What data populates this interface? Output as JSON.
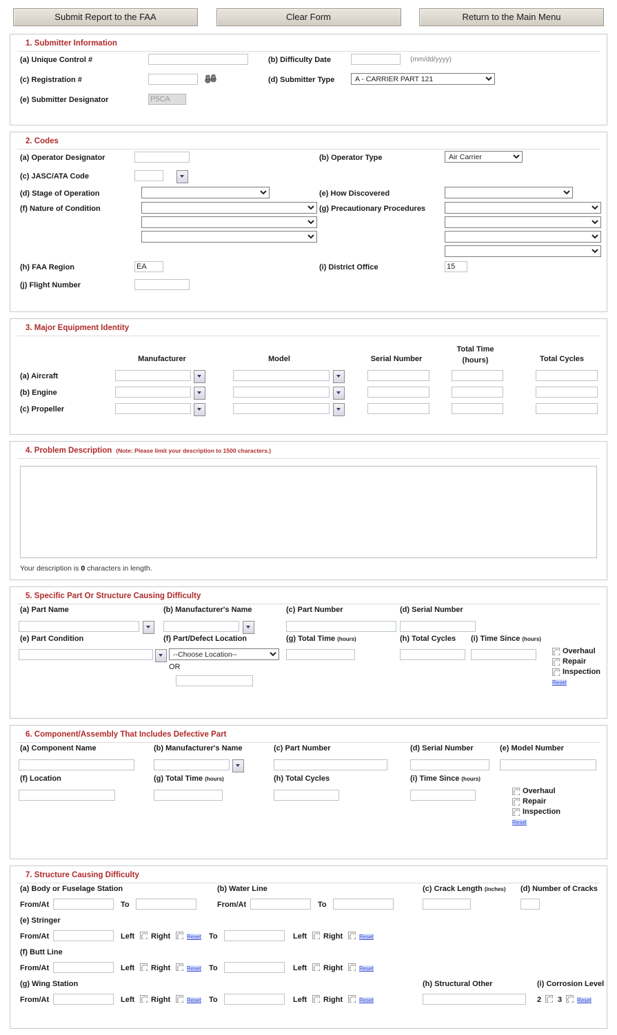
{
  "toolbar": {
    "submit_label": "Submit Report to the FAA",
    "clear_label": "Clear Form",
    "return_label": "Return to the Main Menu"
  },
  "section1": {
    "title": "1. Submitter Information",
    "unique_control_label": "(a) Unique Control #",
    "unique_control_value": "",
    "difficulty_date_label": "(b) Difficulty Date",
    "difficulty_date_value": "",
    "difficulty_date_format": "(mm/dd/yyyy)",
    "registration_label": "(c) Registration #",
    "registration_value": "",
    "submitter_type_label": "(d) Submitter Type",
    "submitter_type_value": "A - CARRIER PART 121",
    "submitter_designator_label": "(e) Submitter Designator",
    "submitter_designator_value": "P5CA"
  },
  "section2": {
    "title": "2. Codes",
    "operator_designator_label": "(a) Operator Designator",
    "operator_designator_value": "",
    "operator_type_label": "(b) Operator Type",
    "operator_type_value": "Air Carrier",
    "jasc_label": "(c) JASC/ATA Code",
    "jasc_value": "",
    "stage_label": "(d) Stage of Operation",
    "stage_value": "",
    "how_discovered_label": "(e) How Discovered",
    "how_discovered_value": "",
    "nature_label": "(f) Nature of Condition",
    "nature_values": [
      "",
      "",
      ""
    ],
    "precautionary_label": "(g) Precautionary Procedures",
    "precautionary_values": [
      "",
      "",
      "",
      ""
    ],
    "faa_region_label": "(h) FAA Region",
    "faa_region_value": "EA",
    "district_office_label": "(i) District Office",
    "district_office_value": "15",
    "flight_number_label": "(j) Flight Number",
    "flight_number_value": ""
  },
  "section3": {
    "title": "3. Major Equipment Identity",
    "col_manufacturer": "Manufacturer",
    "col_model": "Model",
    "col_serial": "Serial Number",
    "col_total_time": "Total Time",
    "col_total_time_unit": "(hours)",
    "col_total_cycles": "Total Cycles",
    "rows": [
      {
        "label": "(a) Aircraft",
        "manufacturer": "",
        "model": "",
        "serial": "",
        "total_time": "",
        "total_cycles": ""
      },
      {
        "label": "(b) Engine",
        "manufacturer": "",
        "model": "",
        "serial": "",
        "total_time": "",
        "total_cycles": ""
      },
      {
        "label": "(c) Propeller",
        "manufacturer": "",
        "model": "",
        "serial": "",
        "total_time": "",
        "total_cycles": ""
      }
    ]
  },
  "section4": {
    "title": "4. Problem Description",
    "note": "(Note: Please limit your description to 1500 characters.)",
    "description_value": "",
    "char_prefix": "Your description is",
    "char_count": "0",
    "char_suffix": "characters in length."
  },
  "section5": {
    "title": "5. Specific Part Or Structure Causing Difficulty",
    "part_name_label": "(a) Part Name",
    "part_name_value": "",
    "manufacturer_label": "(b) Manufacturer's Name",
    "manufacturer_value": "",
    "part_number_label": "(c) Part Number",
    "part_number_value": "",
    "serial_number_label": "(d) Serial Number",
    "serial_number_value": "",
    "part_condition_label": "(e) Part Condition",
    "part_condition_value": "",
    "defect_location_label": "(f) Part/Defect Location",
    "defect_location_value": "--Choose Location--",
    "or_label": "OR",
    "defect_location_other_value": "",
    "total_time_label": "(g) Total Time",
    "total_time_unit": "(hours)",
    "total_time_value": "",
    "total_cycles_label": "(h) Total Cycles",
    "total_cycles_value": "",
    "time_since_label": "(i) Time Since",
    "time_since_unit": "(hours)",
    "time_since_value": "",
    "radio_overhaul": "Overhaul",
    "radio_repair": "Repair",
    "radio_inspection": "Inspection",
    "reset_label": "Reset"
  },
  "section6": {
    "title": "6. Component/Assembly That Includes Defective Part",
    "component_name_label": "(a) Component Name",
    "component_name_value": "",
    "manufacturer_label": "(b) Manufacturer's Name",
    "manufacturer_value": "",
    "part_number_label": "(c) Part Number",
    "part_number_value": "",
    "serial_number_label": "(d) Serial Number",
    "serial_number_value": "",
    "model_number_label": "(e) Model Number",
    "model_number_value": "",
    "location_label": "(f) Location",
    "location_value": "",
    "total_time_label": "(g) Total Time",
    "total_time_unit": "(hours)",
    "total_time_value": "",
    "total_cycles_label": "(h) Total Cycles",
    "total_cycles_value": "",
    "time_since_label": "(i) Time Since",
    "time_since_unit": "(hours)",
    "time_since_value": "",
    "radio_overhaul": "Overhaul",
    "radio_repair": "Repair",
    "radio_inspection": "Inspection",
    "reset_label": "Reset"
  },
  "section7": {
    "title": "7. Structure Causing Difficulty",
    "body_station_label": "(a) Body or Fuselage Station",
    "water_line_label": "(b) Water Line",
    "crack_length_label": "(c) Crack Length",
    "crack_length_unit": "(inches)",
    "crack_length_value": "",
    "number_of_cracks_label": "(d) Number of Cracks",
    "number_of_cracks_value": "",
    "from_at_label": "From/At",
    "to_label": "To",
    "left_label": "Left",
    "right_label": "Right",
    "reset_label": "Reset",
    "body_from_value": "",
    "body_to_value": "",
    "water_from_value": "",
    "water_to_value": "",
    "stringer_label": "(e) Stringer",
    "stringer_from_value": "",
    "stringer_to_value": "",
    "butt_line_label": "(f) Butt Line",
    "butt_from_value": "",
    "butt_to_value": "",
    "wing_station_label": "(g) Wing Station",
    "wing_from_value": "",
    "wing_to_value": "",
    "structural_other_label": "(h) Structural Other",
    "structural_other_value": "",
    "corrosion_level_label": "(i) Corrosion Level",
    "corrosion_level_2": "2",
    "corrosion_level_3": "3"
  }
}
